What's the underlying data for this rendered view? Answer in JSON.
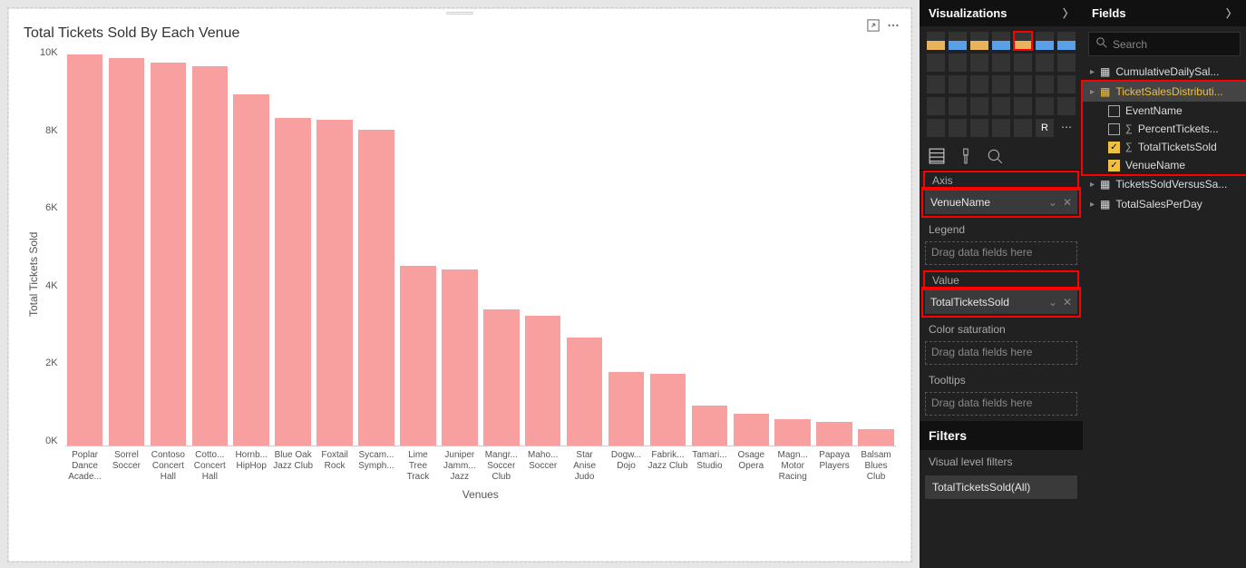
{
  "panels": {
    "visualizations": "Visualizations",
    "fields": "Fields",
    "filters": "Filters",
    "search_placeholder": "Search"
  },
  "wells": {
    "axis_label": "Axis",
    "axis_value": "VenueName",
    "legend_label": "Legend",
    "legend_placeholder": "Drag data fields here",
    "value_label": "Value",
    "value_value": "TotalTicketsSold",
    "color_label": "Color saturation",
    "color_placeholder": "Drag data fields here",
    "tooltips_label": "Tooltips",
    "tooltips_placeholder": "Drag data fields here"
  },
  "filters": {
    "visual_level": "Visual level filters",
    "item1": "TotalTicketsSold(All)"
  },
  "tables": {
    "t1": "CumulativeDailySal...",
    "t2": "TicketSalesDistributi...",
    "t2_fields": {
      "f1": "EventName",
      "f2": "PercentTickets...",
      "f3": "TotalTicketsSold",
      "f4": "VenueName"
    },
    "t3": "TicketsSoldVersusSa...",
    "t4": "TotalSalesPerDay"
  },
  "chart_data": {
    "type": "bar",
    "title": "Total Tickets Sold By Each Venue",
    "xlabel": "Venues",
    "ylabel": "Total Tickets Sold",
    "ylim": [
      0,
      10000
    ],
    "yticks": [
      "0K",
      "2K",
      "4K",
      "6K",
      "8K",
      "10K"
    ],
    "categories": [
      "Poplar Dance Acade...",
      "Sorrel Soccer",
      "Contoso Concert Hall",
      "Cotto... Concert Hall",
      "Hornb... HipHop",
      "Blue Oak Jazz Club",
      "Foxtail Rock",
      "Sycam... Symph...",
      "Lime Tree Track",
      "Juniper Jamm... Jazz",
      "Mangr... Soccer Club",
      "Maho... Soccer",
      "Star Anise Judo",
      "Dogw... Dojo",
      "Fabrik... Jazz Club",
      "Tamari... Studio",
      "Osage Opera",
      "Magn... Motor Racing",
      "Papaya Players",
      "Balsam Blues Club"
    ],
    "values": [
      9800,
      9700,
      9600,
      9500,
      8800,
      8200,
      8150,
      7900,
      4500,
      4400,
      3400,
      3250,
      2700,
      1850,
      1800,
      1000,
      800,
      650,
      600,
      400
    ]
  }
}
